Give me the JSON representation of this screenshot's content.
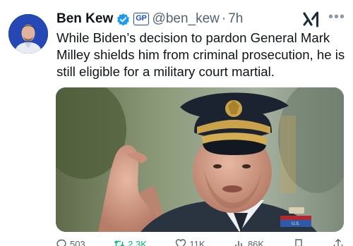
{
  "author": {
    "display_name": "Ben Kew",
    "affiliation_badge": "GP",
    "handle": "@ben_kew",
    "separator": "·",
    "time": "7h"
  },
  "tweet": {
    "text": "While Biden’s decision to pardon General Mark Milley shields him from criminal prosecution, he is still eligible for a military court martial."
  },
  "media": {
    "cap_badge_text": "U.S."
  },
  "actions": {
    "replies": "503",
    "retweets": "2.3K",
    "likes": "11K",
    "views": "86K"
  },
  "colors": {
    "verified": "#1d9bf0",
    "retweet": "#00ba7c",
    "secondary_text": "#536471"
  },
  "icons": [
    "verified-badge-icon",
    "xai-grok-icon",
    "more-icon",
    "reply-icon",
    "retweet-icon",
    "like-icon",
    "views-icon",
    "bookmark-icon",
    "share-icon"
  ]
}
